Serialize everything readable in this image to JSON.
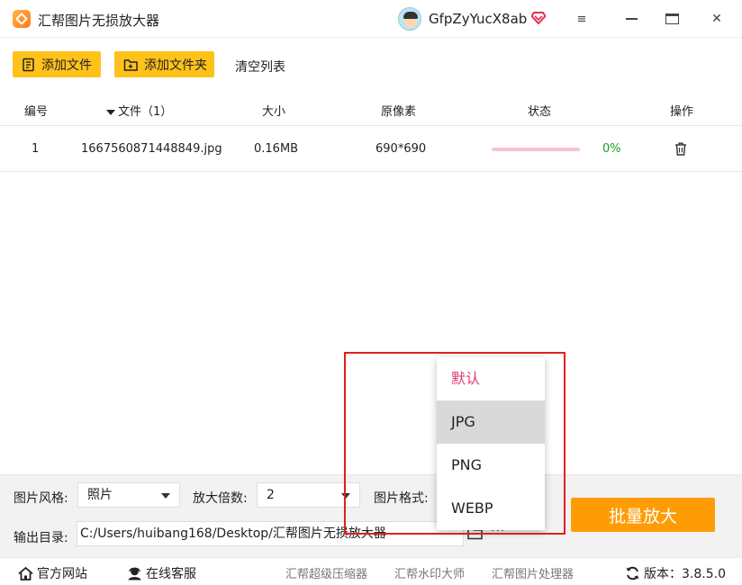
{
  "app": {
    "title": "汇帮图片无损放大器",
    "username": "GfpZyYucX8ab"
  },
  "window": {
    "menu_icon": "≡",
    "maximize_icon": "☐",
    "close_icon": "✕"
  },
  "toolbar": {
    "add_file": "添加文件",
    "add_folder": "添加文件夹",
    "clear_list": "清空列表"
  },
  "table": {
    "headers": {
      "index": "编号",
      "file": "文件（1）",
      "size": "大小",
      "resolution": "原像素",
      "status": "状态",
      "action": "操作"
    },
    "rows": [
      {
        "index": "1",
        "file": "1667560871448849.jpg",
        "size": "0.16MB",
        "resolution": "690*690",
        "progress": 0,
        "progress_text": "0%"
      }
    ]
  },
  "settings": {
    "style_label": "图片风格:",
    "style_value": "照片",
    "scale_label": "放大倍数:",
    "scale_value": "2",
    "format_label": "图片格式:",
    "output_label": "输出目录:",
    "output_path": "C:/Users/huibang168/Desktop/汇帮图片无损放大器",
    "more": "···",
    "batch_button": "批量放大"
  },
  "format_dropdown": {
    "options": [
      "默认",
      "JPG",
      "PNG",
      "WEBP"
    ],
    "hovered": "JPG"
  },
  "footer": {
    "website": "官方网站",
    "service": "在线客服",
    "link1": "汇帮超级压缩器",
    "link2": "汇帮水印大师",
    "link3": "汇帮图片处理器",
    "version": "版本：3.8.5.0"
  },
  "colors": {
    "accent": "#ffc21a",
    "batch": "#ff9b05",
    "progress": "#f4c6d4",
    "highlight": "#e02020"
  }
}
